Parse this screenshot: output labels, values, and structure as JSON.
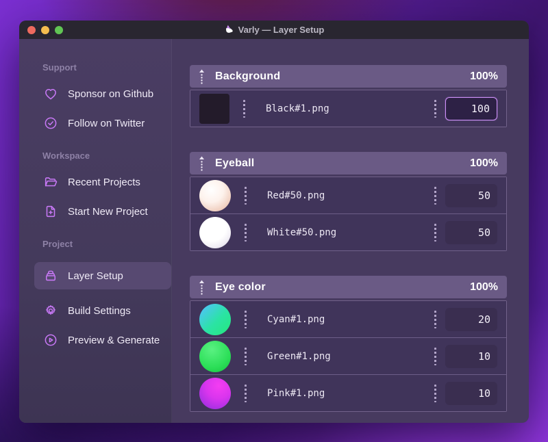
{
  "window": {
    "title": "Varly — Layer Setup"
  },
  "sidebar": {
    "sections": [
      {
        "label": "Support",
        "items": [
          {
            "label": "Sponsor on Github",
            "icon": "heart-icon"
          },
          {
            "label": "Follow on Twitter",
            "icon": "badge-check-icon"
          }
        ]
      },
      {
        "label": "Workspace",
        "items": [
          {
            "label": "Recent Projects",
            "icon": "folder-open-icon"
          },
          {
            "label": "Start New Project",
            "icon": "file-plus-icon"
          }
        ]
      },
      {
        "label": "Project",
        "items": [
          {
            "label": "Layer Setup",
            "icon": "archive-box-icon",
            "active": true
          },
          {
            "label": "Build Settings",
            "icon": "gear-icon"
          },
          {
            "label": "Preview & Generate",
            "icon": "play-circle-icon"
          }
        ]
      }
    ]
  },
  "layers": {
    "groups": [
      {
        "name": "Background",
        "weight": "100%",
        "rows": [
          {
            "filename": "Black#1.png",
            "value": "100",
            "thumb": "black-square",
            "focused": true
          }
        ]
      },
      {
        "name": "Eyeball",
        "weight": "100%",
        "rows": [
          {
            "filename": "Red#50.png",
            "value": "50",
            "thumb": "red-sphere"
          },
          {
            "filename": "White#50.png",
            "value": "50",
            "thumb": "white-sphere"
          }
        ]
      },
      {
        "name": "Eye color",
        "weight": "100%",
        "rows": [
          {
            "filename": "Cyan#1.png",
            "value": "20",
            "thumb": "cyan-sphere"
          },
          {
            "filename": "Green#1.png",
            "value": "10",
            "thumb": "green-sphere"
          },
          {
            "filename": "Pink#1.png",
            "value": "10",
            "thumb": "pink-sphere"
          }
        ]
      }
    ]
  },
  "colors": {
    "accent": "#c778f5",
    "focus_border": "#cd90f8",
    "titlebar_bg": "#292630",
    "group_header_bg": "#6a5a85",
    "row_bg": "#40345a",
    "traffic_red": "#ee6a5f",
    "traffic_yellow": "#f5bd4f",
    "traffic_green": "#61c554",
    "thumb_black": "#231b2a",
    "thumb_cyan": "#2be3a4",
    "thumb_green": "#2cdf58",
    "thumb_pink": "#da35ee"
  }
}
